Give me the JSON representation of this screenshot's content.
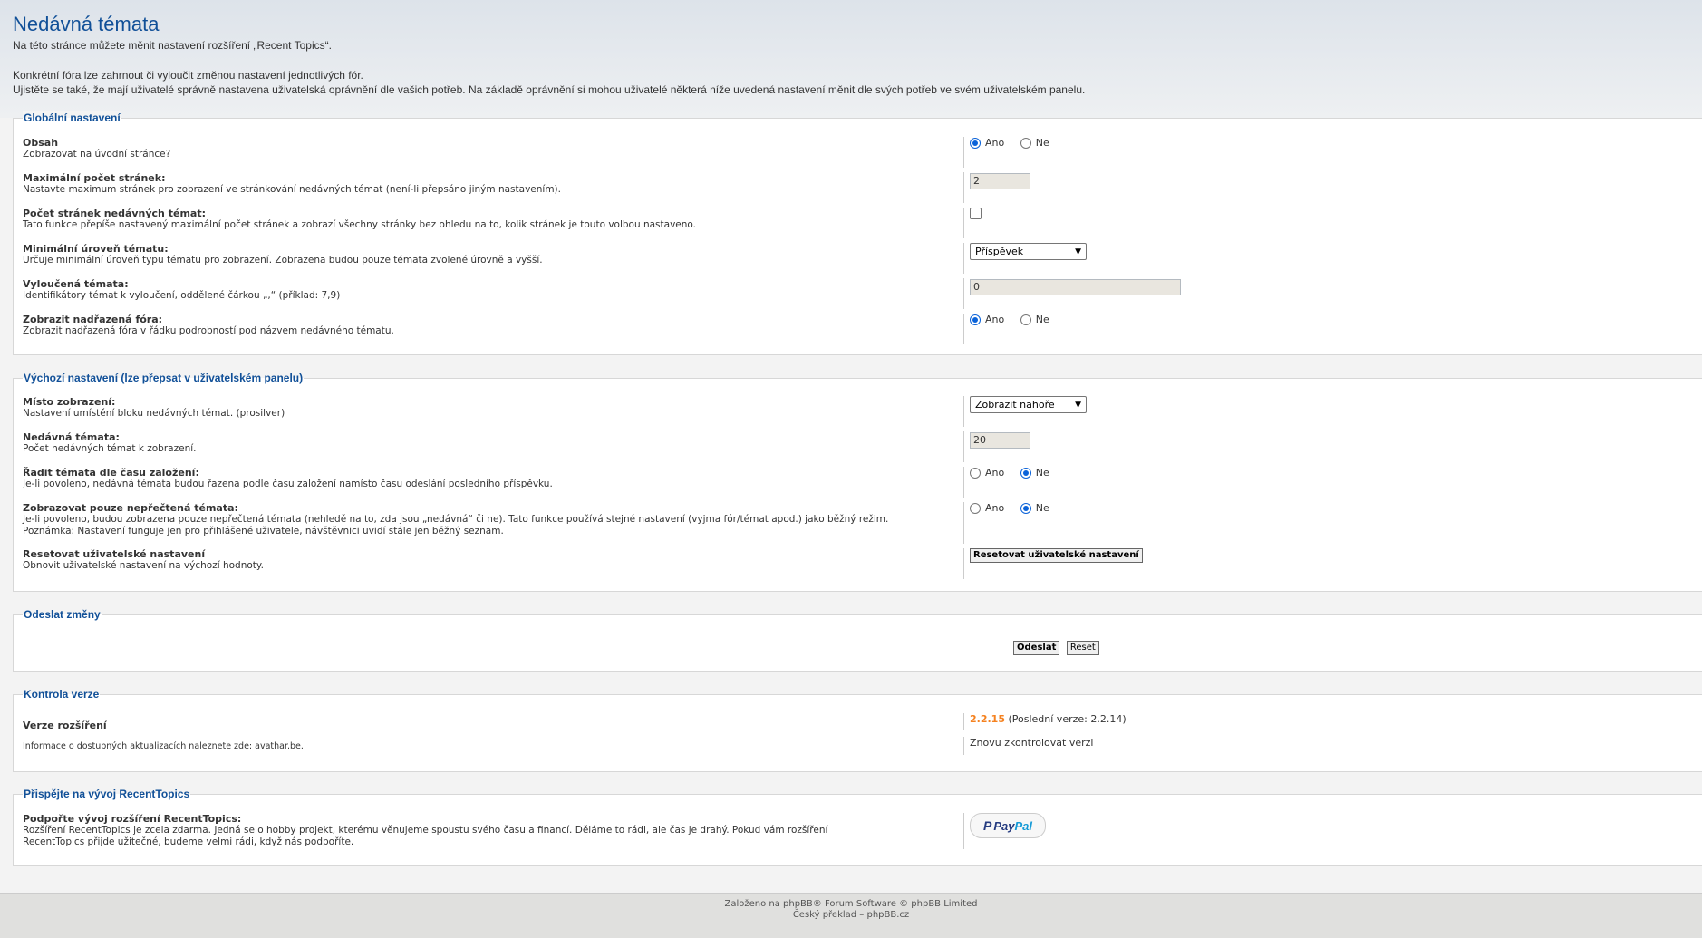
{
  "page": {
    "title": "Nedávná témata",
    "intro_line1": "Na této stránce můžete měnit nastavení rozšíření „Recent Topics“.",
    "intro_line2": "Konkrétní fóra lze zahrnout či vyloučit změnou nastavení jednotlivých fór.",
    "intro_line3": "Ujistěte se také, že mají uživatelé správně nastavena uživatelská oprávnění dle vašich potřeb. Na základě oprávnění si mohou uživatelé některá níže uvedená nastavení měnit dle svých potřeb ve svém uživatelském panelu."
  },
  "radio_labels": {
    "yes": "Ano",
    "no": "Ne"
  },
  "global": {
    "legend": "Globální nastavení",
    "obsah": {
      "title": "Obsah",
      "desc": "Zobrazovat na úvodní stránce?",
      "value": "yes"
    },
    "max_pages": {
      "title": "Maximální počet stránek:",
      "desc": "Nastavte maximum stránek pro zobrazení ve stránkování nedávných témat (není-li přepsáno jiným nastavením).",
      "value": "2"
    },
    "all_pages": {
      "title": "Počet stránek nedávných témat:",
      "desc": "Tato funkce přepíše nastavený maximální počet stránek a zobrazí všechny stránky bez ohledu na to, kolik stránek je touto volbou nastaveno.",
      "checked": false
    },
    "min_level": {
      "title": "Minimální úroveň tématu:",
      "desc": "Určuje minimální úroveň typu tématu pro zobrazení. Zobrazena budou pouze témata zvolené úrovně a vyšší.",
      "selected": "Příspěvek"
    },
    "excluded": {
      "title": "Vyloučená témata:",
      "desc": "Identifikátory témat k vyloučení, oddělené čárkou „,“ (příklad: 7,9)",
      "value": "0"
    },
    "parent": {
      "title": "Zobrazit nadřazená fóra:",
      "desc": "Zobrazit nadřazená fóra v řádku podrobností pod názvem nedávného tématu.",
      "value": "yes"
    }
  },
  "defaults": {
    "legend": "Výchozí nastavení (lze přepsat v uživatelském panelu)",
    "location": {
      "title": "Místo zobrazení:",
      "desc": "Nastavení umístění bloku nedávných témat. (prosilver)",
      "selected": "Zobrazit nahoře"
    },
    "count": {
      "title": "Nedávná témata:",
      "desc": "Počet nedávných témat k zobrazení.",
      "value": "20"
    },
    "sort": {
      "title": "Řadit témata dle času založení:",
      "desc": "Je-li povoleno, nedávná témata budou řazena podle času založení namísto času odeslání posledního příspěvku.",
      "value": "no"
    },
    "unread": {
      "title": "Zobrazovat pouze nepřečtená témata:",
      "desc1": "Je-li povoleno, budou zobrazena pouze nepřečtená témata (nehledě na to, zda jsou „nedávná“ či ne). Tato funkce používá stejné nastavení (vyjma fór/témat apod.) jako běžný režim.",
      "desc2": "Poznámka: Nastavení funguje jen pro přihlášené uživatele, návštěvnici uvidí stále jen běžný seznam.",
      "value": "no"
    },
    "reset": {
      "title": "Resetovat uživatelské nastavení",
      "desc": "Obnovit uživatelské nastavení na výchozí hodnoty.",
      "button": "Resetovat uživatelské nastavení"
    }
  },
  "submit": {
    "legend": "Odeslat změny",
    "submit_label": "Odeslat",
    "reset_label": "Reset"
  },
  "version": {
    "legend": "Kontrola verze",
    "title": "Verze rozšíření",
    "info": "Informace o dostupných aktualizacích naleznete zde: avathar.be.",
    "current": "2.2.15",
    "latest": "(Poslední verze: 2.2.14)",
    "recheck": "Znovu zkontrolovat verzi",
    "current_color": "#f58220"
  },
  "donate": {
    "legend": "Přispějte na vývoj RecentTopics",
    "title": "Podpořte vývoj rozšíření RecentTopics:",
    "desc1": "Rozšíření RecentTopics je zcela zdarma. Jedná se o hobby projekt, kterému věnujeme spoustu svého času a financí. Děláme to rádi, ale čas je drahý. Pokud vám rozšíření",
    "desc2": "RecentTopics přijde užitečné, budeme velmi rádi, když nás podpoříte.",
    "paypal_pay": "Pay",
    "paypal_pal": "Pal"
  },
  "footer": {
    "line1": "Založeno na phpBB® Forum Software © phpBB Limited",
    "line2": "Český překlad – phpBB.cz"
  }
}
